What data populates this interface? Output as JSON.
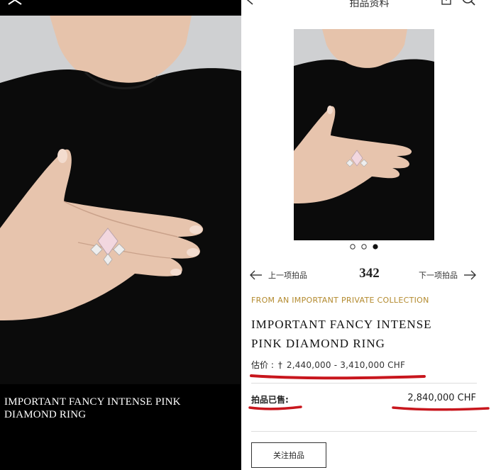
{
  "left": {
    "caption": "IMPORTANT FANCY INTENSE PINK DIAMOND RING"
  },
  "topbar": {
    "title": "拍品资料"
  },
  "carousel": {
    "active_index": 2,
    "count": 3
  },
  "nav": {
    "prev_label": "上一项拍品",
    "lot_number": "342",
    "next_label": "下一项拍品"
  },
  "lot": {
    "provenance": "FROM AN IMPORTANT PRIVATE COLLECTION",
    "title_line1": "IMPORTANT FANCY INTENSE",
    "title_line2": "PINK DIAMOND RING",
    "estimate_label": "估价 :",
    "dagger": "†",
    "estimate_value": "2,440,000 - 3,410,000 CHF",
    "sold_label": "拍品已售:",
    "sold_price": "2,840,000 CHF",
    "follow_label": "关注拍品"
  },
  "colors": {
    "accent_gold": "#b38a2e",
    "annotation_red": "#c8161d",
    "dress_black": "#0b0b0b",
    "background_grey": "#cfd0d2",
    "skin": "#e7c4ad"
  }
}
